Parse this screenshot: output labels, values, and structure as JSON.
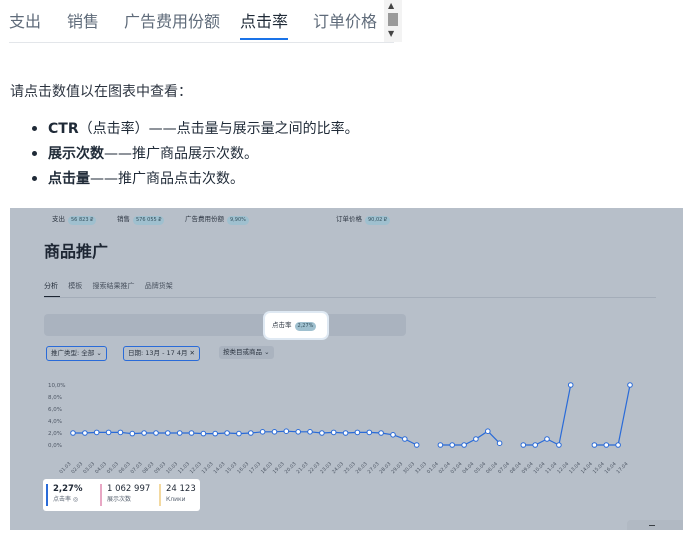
{
  "tabs": [
    "支出",
    "销售",
    "广告费用份额",
    "点击率",
    "订单价格"
  ],
  "active_tab": "点击率",
  "intro": "请点击数值以在图表中查看：",
  "bullets": [
    {
      "bold": "CTR",
      "text": "（点击率）——点击量与展示量之间的比率。"
    },
    {
      "bold": "展示次数",
      "text": "——推广商品展示次数。"
    },
    {
      "bold": "点击量",
      "text": "——推广商品点击次数。"
    }
  ],
  "screenshot": {
    "title": "商品推广",
    "subtabs": [
      "分析",
      "模板",
      "搜索结果推广",
      "品牌货架"
    ],
    "metrics": [
      {
        "label": "支出",
        "value": "56 823 ₽"
      },
      {
        "label": "销售",
        "value": "576 055 ₽"
      },
      {
        "label": "广告费用份额",
        "value": "9,90%"
      },
      {
        "label": "点击率",
        "value": "2,27%"
      },
      {
        "label": "订单价格",
        "value": "90,02 ₽"
      }
    ],
    "filters": {
      "type": "推广类型: 全部 ⌄",
      "date": "日期: 13月 - 17 4月 ✕",
      "target": "按类目或商品 ⌄"
    },
    "stats": [
      {
        "value": "2,27%",
        "label": "点击率 ◎"
      },
      {
        "value": "1 062 997",
        "label": "展示次数"
      },
      {
        "value": "24 123",
        "label": "Клики"
      }
    ]
  },
  "colors": {
    "accent": "#1a73e8",
    "line": "#2a6bd8",
    "panel_bg": "#b7bfc9"
  },
  "chart_data": {
    "type": "line",
    "y_ticks": [
      "10,0%",
      "8,0%",
      "6,0%",
      "4,0%",
      "2,0%",
      "0,0%"
    ],
    "ylim": [
      0,
      10
    ],
    "x": [
      "01.03",
      "02.03",
      "03.03",
      "04.03",
      "05.03",
      "06.03",
      "07.03",
      "08.03",
      "09.03",
      "10.03",
      "11.03",
      "12.03",
      "13.03",
      "14.03",
      "15.03",
      "16.03",
      "17.03",
      "18.03",
      "19.03",
      "20.03",
      "21.03",
      "22.03",
      "23.03",
      "24.03",
      "25.03",
      "26.03",
      "27.03",
      "28.03",
      "29.03",
      "30.03",
      "31.03",
      "01.04",
      "02.04",
      "03.04",
      "04.04",
      "05.04",
      "06.04",
      "07.04",
      "08.04",
      "09.04",
      "10.04",
      "11.04",
      "12.04",
      "13.04",
      "14.04",
      "15.04",
      "16.04",
      "17.04"
    ],
    "series": [
      {
        "values": [
          2.0,
          2.0,
          2.1,
          2.1,
          2.1,
          1.9,
          2.0,
          2.0,
          2.0,
          2.0,
          2.0,
          1.9,
          1.9,
          2.0,
          1.9,
          2.0,
          2.2,
          2.2,
          2.3,
          2.2,
          2.2,
          2.0,
          2.1,
          2.0,
          2.1,
          2.1,
          2.0,
          1.7,
          1.0,
          0.0,
          null,
          0.0,
          0.0,
          0.0,
          1.0,
          2.3,
          0.3,
          null,
          0.0,
          0.0,
          1.0,
          0.0,
          10.0,
          null,
          0.0,
          0.0,
          0.0,
          10.0
        ]
      }
    ]
  }
}
